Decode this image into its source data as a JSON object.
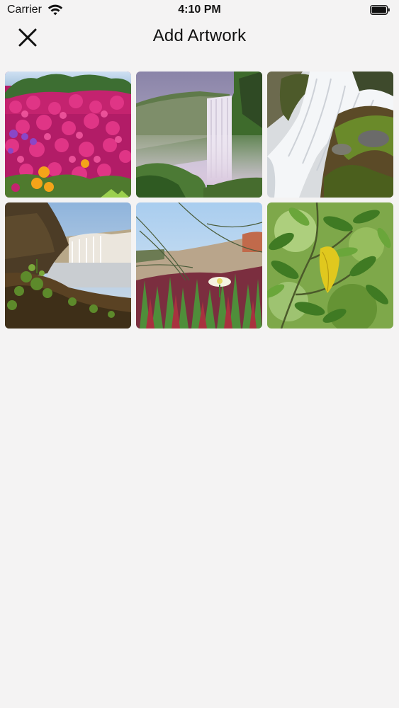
{
  "status_bar": {
    "carrier": "Carrier",
    "time": "4:10 PM",
    "wifi_icon": "wifi-icon",
    "battery_icon": "battery-icon"
  },
  "nav": {
    "title": "Add Artwork",
    "close_icon": "close-icon"
  },
  "artworks": [
    {
      "subject": "pink flowers",
      "alt": "Pink flowers"
    },
    {
      "subject": "waterfall with mist",
      "alt": "Waterfall"
    },
    {
      "subject": "waterfall over mossy rocks",
      "alt": "Waterfall rocks"
    },
    {
      "subject": "waterfall landscape with rocks",
      "alt": "Waterfall landscape"
    },
    {
      "subject": "coastal plants with white flower",
      "alt": "Coastal plants"
    },
    {
      "subject": "green leaves with yellow leaf",
      "alt": "Green leaves"
    }
  ],
  "colors": {
    "background": "#f4f3f3",
    "text": "#111111"
  }
}
